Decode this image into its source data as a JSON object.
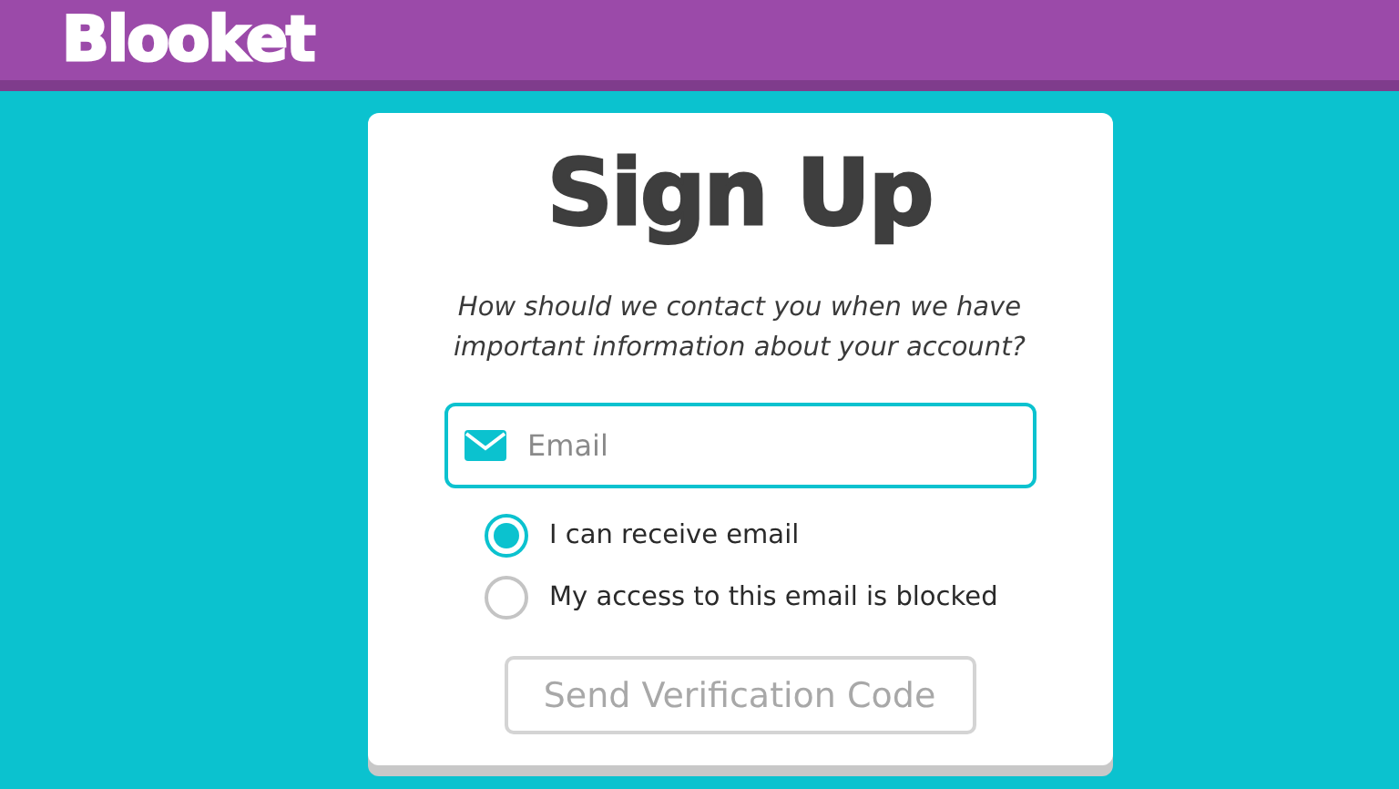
{
  "header": {
    "logo": "Blooket"
  },
  "card": {
    "title": "Sign Up",
    "prompt": "How should we contact you when we have important information about your account?",
    "email_field": {
      "placeholder": "Email"
    },
    "options": [
      {
        "label": "I can receive email",
        "selected": true
      },
      {
        "label": "My access to this email is blocked",
        "selected": false
      }
    ],
    "submit": {
      "label": "Send Verification Code",
      "disabled": true
    }
  }
}
